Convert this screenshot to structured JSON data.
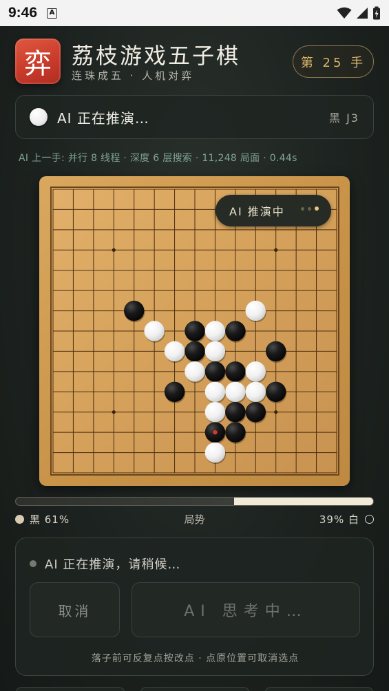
{
  "status_bar": {
    "time": "9:46",
    "notification_icon_letter": "A"
  },
  "header": {
    "logo_char": "弈",
    "title": "荔枝游戏五子棋",
    "subtitle": "连珠成五 · 人机对弈",
    "move_counter": "第 25 手"
  },
  "status_card": {
    "stone_color": "white",
    "text": "AI 正在推演…",
    "last_move": "黑 J3"
  },
  "ai_info": "AI 上一手: 并行 8 线程 · 深度 6 层搜索 · 11,248 局面 · 0.44s",
  "board": {
    "size": 15,
    "star_points": [
      [
        3,
        3
      ],
      [
        3,
        11
      ],
      [
        7,
        7
      ],
      [
        11,
        3
      ],
      [
        11,
        11
      ]
    ],
    "stones": [
      {
        "row": 6,
        "col": 4,
        "color": "black"
      },
      {
        "row": 6,
        "col": 10,
        "color": "white"
      },
      {
        "row": 7,
        "col": 5,
        "color": "white"
      },
      {
        "row": 7,
        "col": 7,
        "color": "black"
      },
      {
        "row": 7,
        "col": 8,
        "color": "white"
      },
      {
        "row": 7,
        "col": 9,
        "color": "black"
      },
      {
        "row": 8,
        "col": 6,
        "color": "white"
      },
      {
        "row": 8,
        "col": 7,
        "color": "black"
      },
      {
        "row": 8,
        "col": 8,
        "color": "white"
      },
      {
        "row": 8,
        "col": 11,
        "color": "black"
      },
      {
        "row": 9,
        "col": 7,
        "color": "white"
      },
      {
        "row": 9,
        "col": 8,
        "color": "black"
      },
      {
        "row": 9,
        "col": 9,
        "color": "black"
      },
      {
        "row": 9,
        "col": 10,
        "color": "white"
      },
      {
        "row": 10,
        "col": 6,
        "color": "black"
      },
      {
        "row": 10,
        "col": 8,
        "color": "white"
      },
      {
        "row": 10,
        "col": 9,
        "color": "white"
      },
      {
        "row": 10,
        "col": 10,
        "color": "white"
      },
      {
        "row": 10,
        "col": 11,
        "color": "black"
      },
      {
        "row": 11,
        "col": 8,
        "color": "white"
      },
      {
        "row": 11,
        "col": 9,
        "color": "black"
      },
      {
        "row": 11,
        "col": 10,
        "color": "black"
      },
      {
        "row": 12,
        "col": 8,
        "color": "black",
        "last": true
      },
      {
        "row": 12,
        "col": 9,
        "color": "black"
      },
      {
        "row": 13,
        "col": 8,
        "color": "white"
      }
    ],
    "ai_pill_text": "AI 推演中"
  },
  "advantage": {
    "black_fraction": 0.61,
    "black_label": "黑 61%",
    "center_label": "局势",
    "white_label": "39% 白"
  },
  "panel": {
    "status_text": "AI 正在推演，请稍候…",
    "cancel_label": "取消",
    "think_label": "AI 思考中…",
    "hint": "落子前可反复点按改点 · 点原位置可取消选点"
  },
  "colors": {
    "accent_gold": "#d8b56c",
    "logo_red": "#c7392a",
    "board_wood": "#c99449",
    "last_move_marker": "#d63a2a"
  }
}
